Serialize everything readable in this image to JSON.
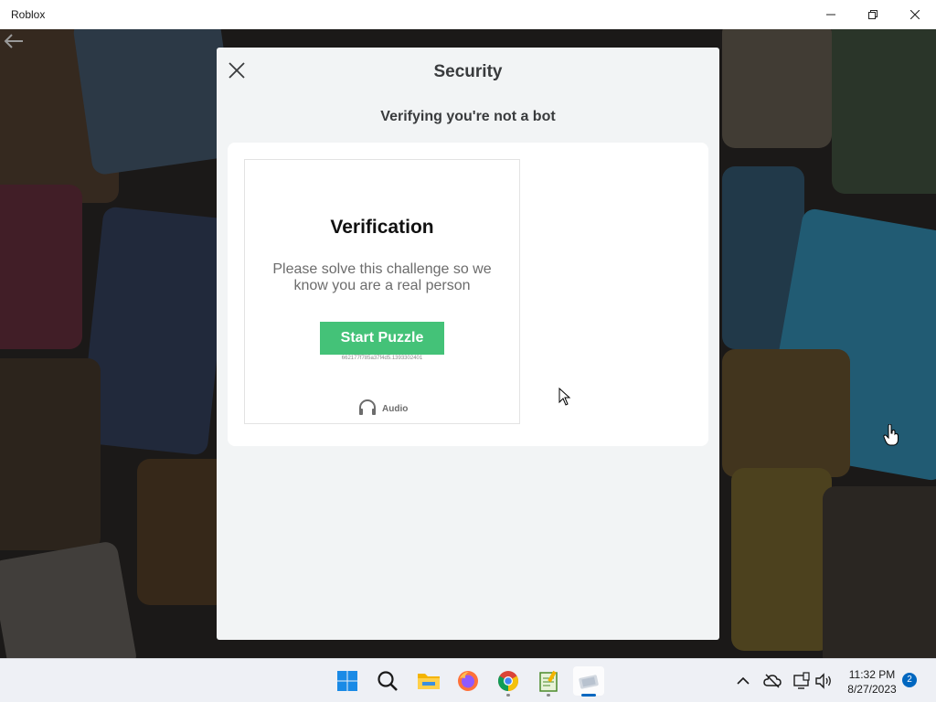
{
  "window": {
    "title": "Roblox"
  },
  "dialog": {
    "title": "Security",
    "subtitle": "Verifying you're not a bot"
  },
  "captcha": {
    "heading": "Verification",
    "instructions": "Please solve this challenge so we know you are a real person",
    "start_button_label": "Start Puzzle",
    "session_id": "662177f785a37f4d5.1393302401",
    "audio_label": "Audio",
    "accent_color": "#44c278"
  },
  "taskbar": {
    "apps": [
      {
        "name": "start",
        "icon": "windows-logo-icon"
      },
      {
        "name": "search",
        "icon": "search-icon"
      },
      {
        "name": "file-explorer",
        "icon": "folder-icon"
      },
      {
        "name": "firefox",
        "icon": "firefox-icon"
      },
      {
        "name": "chrome",
        "icon": "chrome-icon"
      },
      {
        "name": "notepad",
        "icon": "notepad-icon"
      },
      {
        "name": "roblox",
        "icon": "roblox-icon",
        "active": true
      }
    ],
    "clock": {
      "time": "11:32 PM",
      "date": "8/27/2023"
    },
    "notification_count": "2"
  }
}
